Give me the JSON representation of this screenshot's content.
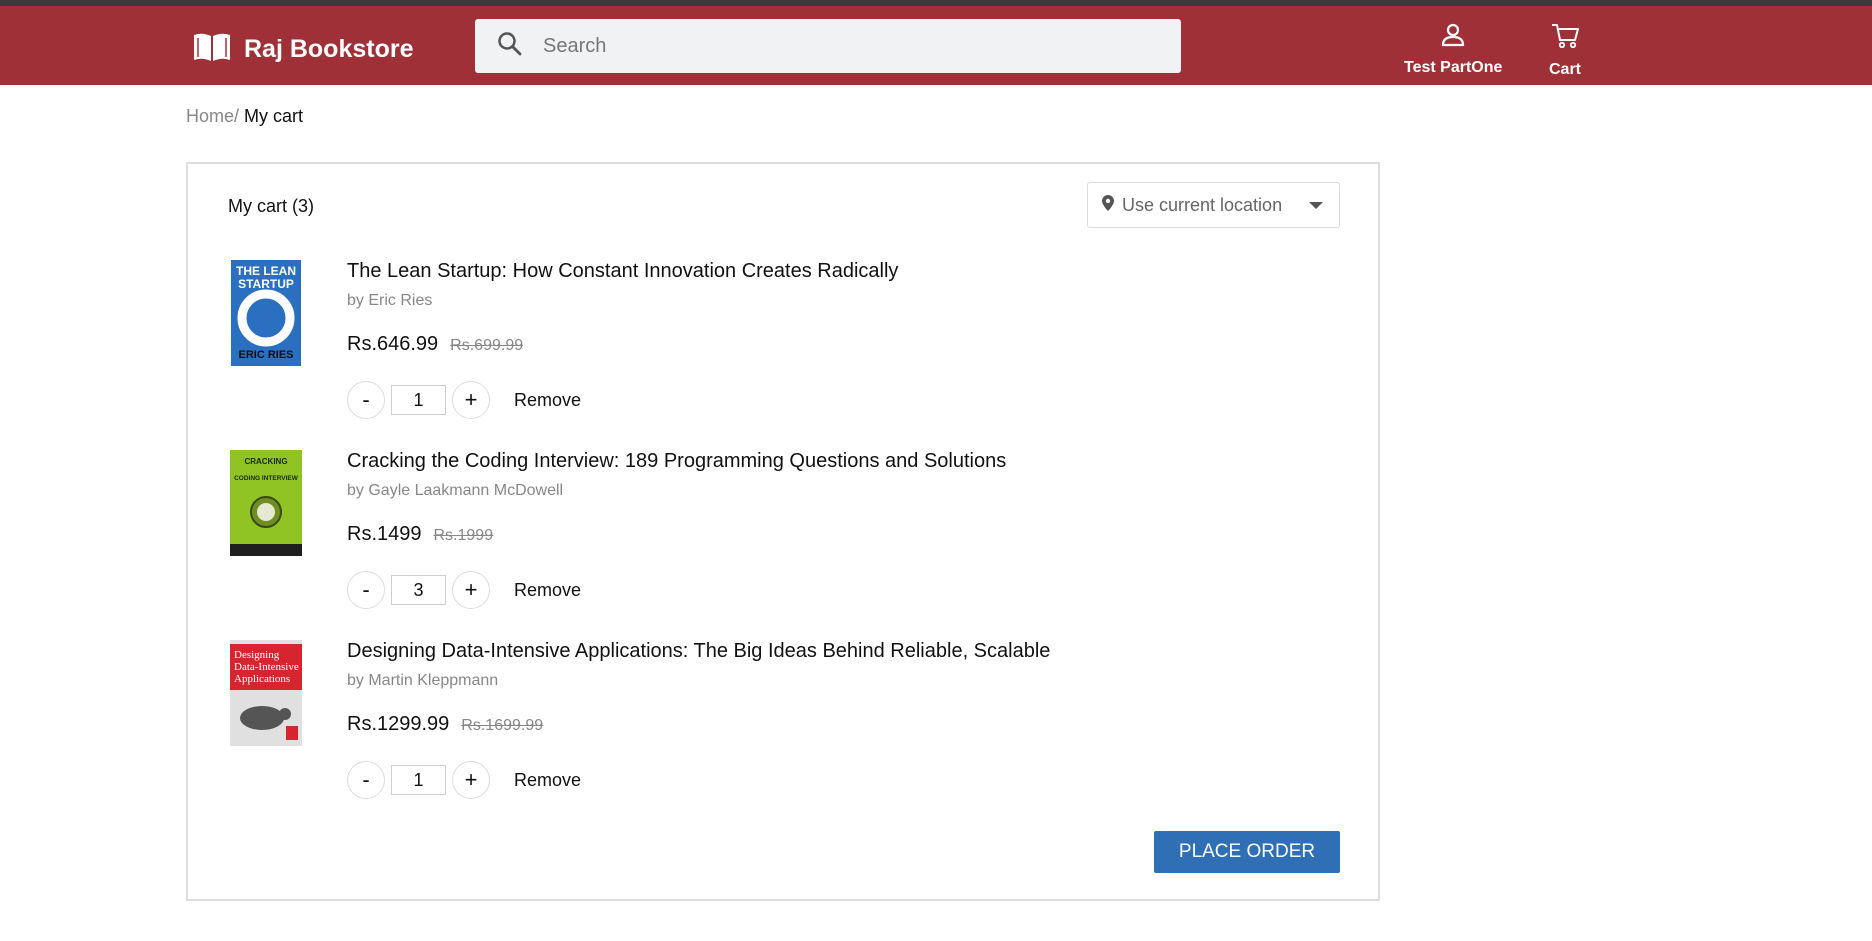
{
  "header": {
    "brand": "Raj Bookstore",
    "search_placeholder": "Search",
    "profile_label": "Test PartOne",
    "cart_label": "Cart"
  },
  "breadcrumb": {
    "home": "Home",
    "separator": "/",
    "current": "My cart"
  },
  "cart": {
    "title": "My cart (3)",
    "location_label": "Use current location",
    "place_order_label": "PLACE ORDER",
    "items": [
      {
        "title": "The Lean Startup: How Constant Innovation Creates Radically",
        "author": "by Eric Ries",
        "price": "Rs.646.99",
        "mrp": "Rs.699.99",
        "quantity": "1",
        "minus": "-",
        "plus": "+",
        "remove": "Remove",
        "cover_text_1": "THE LEAN",
        "cover_text_2": "STARTUP",
        "cover_text_3": "ERIC RIES"
      },
      {
        "title": "Cracking the Coding Interview: 189 Programming Questions and Solutions",
        "author": "by Gayle Laakmann McDowell",
        "price": "Rs.1499",
        "mrp": "Rs.1999",
        "quantity": "3",
        "minus": "-",
        "plus": "+",
        "remove": "Remove",
        "cover_text_1": "CRACKING",
        "cover_text_2": "CODING INTERVIEW"
      },
      {
        "title": "Designing Data-Intensive Applications: The Big Ideas Behind Reliable, Scalable",
        "author": "by Martin Kleppmann",
        "price": "Rs.1299.99",
        "mrp": "Rs.1699.99",
        "quantity": "1",
        "minus": "-",
        "plus": "+",
        "remove": "Remove",
        "cover_text_1": "Designing",
        "cover_text_2": "Data-Intensive",
        "cover_text_3": "Applications"
      }
    ]
  },
  "colors": {
    "header_bg": "#a03037",
    "accent_button": "#2f6fb5",
    "muted_text": "#878787"
  },
  "icons": {
    "logo": "book-icon",
    "search": "search-icon",
    "profile": "user-icon",
    "cart": "cart-icon",
    "location": "map-pin-icon",
    "dropdown": "caret-down-icon"
  }
}
